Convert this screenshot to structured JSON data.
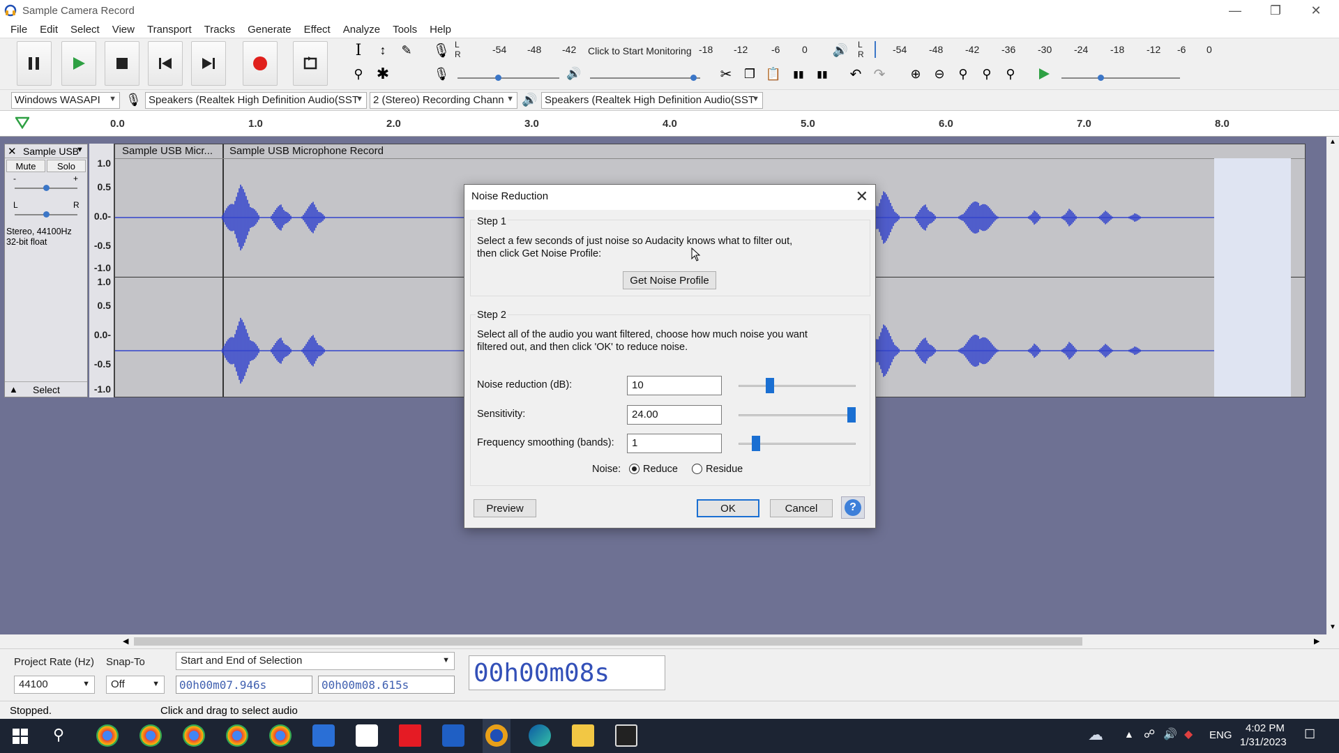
{
  "window": {
    "title": "Sample Camera Record"
  },
  "menu": [
    "File",
    "Edit",
    "Select",
    "View",
    "Transport",
    "Tracks",
    "Generate",
    "Effect",
    "Analyze",
    "Tools",
    "Help"
  ],
  "meters": {
    "record_ticks": [
      "-54",
      "-48",
      "-42",
      "-18",
      "-12",
      "-6",
      "0"
    ],
    "monitor_label": "Click to Start Monitoring",
    "playback_ticks": [
      "-54",
      "-48",
      "-42",
      "-36",
      "-30",
      "-24",
      "-18",
      "-12",
      "-6",
      "0"
    ],
    "lr": [
      "L",
      "R"
    ]
  },
  "device": {
    "host": "Windows WASAPI",
    "recording_device": "Speakers (Realtek High Definition Audio(SST",
    "channels": "2 (Stereo) Recording Chann",
    "playback_device": "Speakers (Realtek High Definition Audio(SST"
  },
  "ruler": {
    "labels": [
      "0.0",
      "1.0",
      "2.0",
      "3.0",
      "4.0",
      "5.0",
      "6.0",
      "7.0",
      "8.0"
    ]
  },
  "track": {
    "name": "Sample USB",
    "mute": "Mute",
    "solo": "Solo",
    "gain_minus": "-",
    "gain_plus": "+",
    "pan_left": "L",
    "pan_right": "R",
    "info_line1": "Stereo, 44100Hz",
    "info_line2": "32-bit float",
    "select": "Select",
    "clip1": "Sample USB Micr...",
    "clip2": "Sample USB Microphone  Record",
    "vruler": [
      "1.0",
      "0.5",
      "0.0-",
      "-0.5",
      "-1.0",
      "1.0",
      "0.5",
      "0.0-",
      "-0.5",
      "-1.0"
    ]
  },
  "dialog": {
    "title": "Noise Reduction",
    "step1_title": "Step 1",
    "step1_line1": "Select a few seconds of just noise so Audacity knows what to filter out,",
    "step1_line2": "then click Get Noise Profile:",
    "get_profile": "Get Noise Profile",
    "step2_title": "Step 2",
    "step2_line1": "Select all of the audio you want filtered, choose how much noise you want",
    "step2_line2": "filtered out, and then click 'OK' to reduce noise.",
    "noise_reduction_label": "Noise reduction (dB):",
    "noise_reduction_value": "10",
    "noise_reduction_level": 0.25,
    "sensitivity_label": "Sensitivity:",
    "sensitivity_value": "24.00",
    "sensitivity_level": 1.0,
    "freq_label": "Frequency smoothing (bands):",
    "freq_value": "1",
    "freq_level": 0.12,
    "noise_label": "Noise:",
    "reduce": "Reduce",
    "residue": "Residue",
    "preview": "Preview",
    "ok": "OK",
    "cancel": "Cancel",
    "help": "?"
  },
  "selection": {
    "project_rate_label": "Project Rate (Hz)",
    "project_rate": "44100",
    "snap_label": "Snap-To",
    "snap": "Off",
    "mode": "Start and End of Selection",
    "start": "00h00m07.946s",
    "end": "00h00m08.615s",
    "audio_position": "00h00m08s"
  },
  "status": {
    "state": "Stopped.",
    "hint": "Click and drag to select audio"
  },
  "taskbar": {
    "lang": "ENG",
    "time": "4:02 PM",
    "date": "1/31/2023"
  },
  "colors": {
    "waveform": "#3344cc",
    "track_bg": "#6e7193",
    "accent": "#1a6fd2"
  }
}
